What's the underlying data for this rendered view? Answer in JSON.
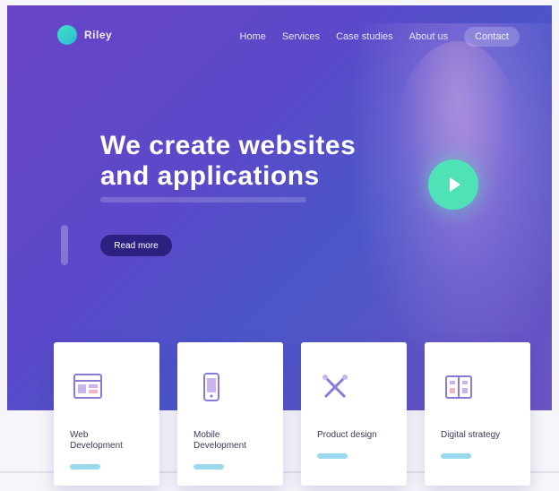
{
  "brand": {
    "name": "Riley"
  },
  "nav": {
    "items": [
      "Home",
      "Services",
      "Case studies",
      "About us"
    ],
    "cta": "Contact"
  },
  "hero": {
    "headline_line1": "We create websites",
    "headline_line2": "and applications",
    "button_label": "Read more"
  },
  "cards": [
    {
      "title": "Web Development",
      "icon": "grid-layout-icon"
    },
    {
      "title": "Mobile Development",
      "icon": "mobile-icon"
    },
    {
      "title": "Product design",
      "icon": "tools-icon"
    },
    {
      "title": "Digital strategy",
      "icon": "strategy-icon"
    }
  ],
  "colors": {
    "hero_gradient_start": "#6a45c7",
    "hero_gradient_end": "#4b56c8",
    "play_button": "#4fe2b6",
    "primary_button": "#2c2180",
    "card_link": "#9ad8ee"
  }
}
